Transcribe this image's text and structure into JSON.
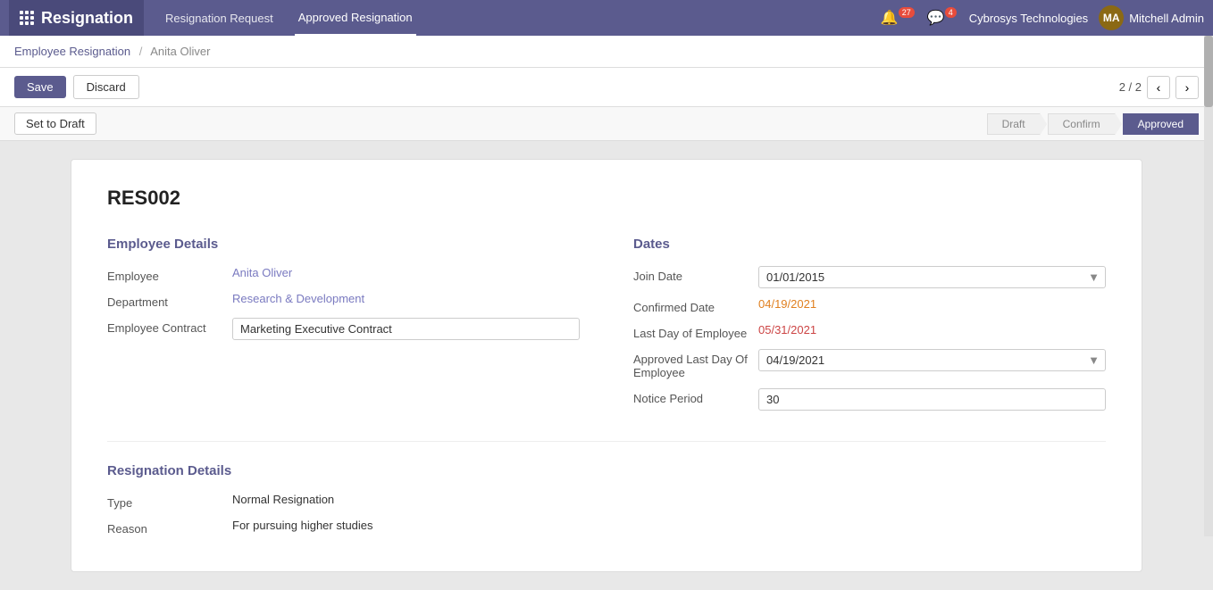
{
  "app": {
    "title": "Resignation",
    "nav": [
      {
        "label": "Resignation Request",
        "active": false
      },
      {
        "label": "Approved Resignation",
        "active": true
      }
    ]
  },
  "topbar": {
    "notifications_count": "27",
    "messages_count": "4",
    "company": "Cybrosys Technologies",
    "user": "Mitchell Admin",
    "avatar_initials": "MA"
  },
  "breadcrumb": {
    "parent": "Employee Resignation",
    "separator": "/",
    "current": "Anita Oliver"
  },
  "toolbar": {
    "save_label": "Save",
    "discard_label": "Discard",
    "pagination": "2 / 2"
  },
  "status_bar": {
    "set_draft_label": "Set to Draft",
    "steps": [
      {
        "label": "Draft",
        "active": false
      },
      {
        "label": "Confirm",
        "active": false
      },
      {
        "label": "Approved",
        "active": true
      }
    ]
  },
  "document": {
    "id": "RES002",
    "employee_details": {
      "section_title": "Employee Details",
      "fields": [
        {
          "label": "Employee",
          "value": "Anita Oliver",
          "type": "link"
        },
        {
          "label": "Department",
          "value": "Research & Development",
          "type": "link"
        },
        {
          "label": "Employee Contract",
          "value": "Marketing Executive Contract",
          "type": "input"
        }
      ]
    },
    "dates": {
      "section_title": "Dates",
      "fields": [
        {
          "label": "Join Date",
          "value": "01/01/2015",
          "type": "date-input"
        },
        {
          "label": "Confirmed Date",
          "value": "04/19/2021",
          "type": "orange-text"
        },
        {
          "label": "Last Day of Employee",
          "value": "05/31/2021",
          "type": "red-text"
        },
        {
          "label": "Approved Last Day Of Employee",
          "value": "04/19/2021",
          "type": "date-input"
        },
        {
          "label": "Notice Period",
          "value": "30",
          "type": "input"
        }
      ]
    },
    "resignation_details": {
      "section_title": "Resignation Details",
      "fields": [
        {
          "label": "Type",
          "value": "Normal Resignation",
          "type": "text"
        },
        {
          "label": "Reason",
          "value": "For pursuing higher studies",
          "type": "text"
        }
      ]
    }
  }
}
